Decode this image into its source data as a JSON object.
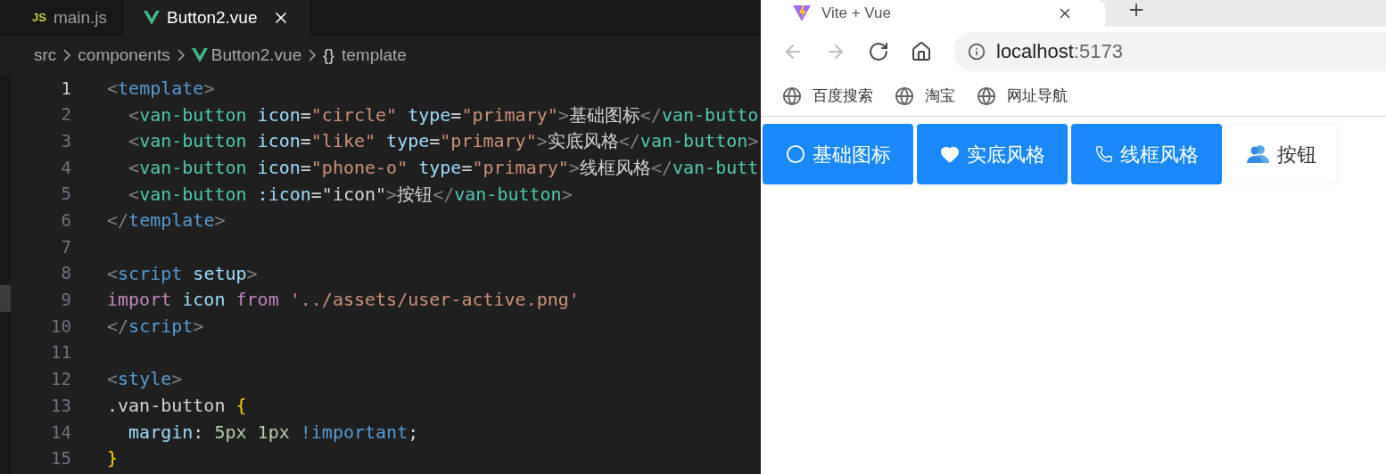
{
  "editor": {
    "tabs": [
      {
        "label": "main.js",
        "kind": "js",
        "badge": "JS",
        "selected": false
      },
      {
        "label": "Button2.vue",
        "kind": "vue",
        "selected": true
      }
    ],
    "breadcrumb": [
      {
        "label": "src",
        "kind": "folder"
      },
      {
        "label": "components",
        "kind": "folder"
      },
      {
        "label": "Button2.vue",
        "kind": "vue"
      },
      {
        "label": "template",
        "kind": "symbol",
        "glyph": "{}"
      }
    ],
    "lines": [
      {
        "number": "1",
        "active": true,
        "tokens": [
          {
            "kind": "punct",
            "text": "<"
          },
          {
            "kind": "tag",
            "text": "template"
          },
          {
            "kind": "punct",
            "text": ">"
          }
        ]
      },
      {
        "number": "2",
        "active": false,
        "tokens": [
          {
            "kind": "punct",
            "text": "  <"
          },
          {
            "kind": "component",
            "text": "van-button"
          },
          {
            "kind": "attr",
            "text": " icon"
          },
          {
            "kind": "plain",
            "text": "="
          },
          {
            "kind": "string",
            "text": "\"circle\""
          },
          {
            "kind": "attr",
            "text": " type"
          },
          {
            "kind": "plain",
            "text": "="
          },
          {
            "kind": "string",
            "text": "\"primary\""
          },
          {
            "kind": "punct",
            "text": ">"
          },
          {
            "kind": "plain",
            "text": "基础图标"
          },
          {
            "kind": "punct",
            "text": "</"
          },
          {
            "kind": "component",
            "text": "van-butto"
          }
        ]
      },
      {
        "number": "3",
        "active": false,
        "tokens": [
          {
            "kind": "punct",
            "text": "  <"
          },
          {
            "kind": "component",
            "text": "van-button"
          },
          {
            "kind": "attr",
            "text": " icon"
          },
          {
            "kind": "plain",
            "text": "="
          },
          {
            "kind": "string",
            "text": "\"like\""
          },
          {
            "kind": "attr",
            "text": " type"
          },
          {
            "kind": "plain",
            "text": "="
          },
          {
            "kind": "string",
            "text": "\"primary\""
          },
          {
            "kind": "punct",
            "text": ">"
          },
          {
            "kind": "plain",
            "text": "实底风格"
          },
          {
            "kind": "punct",
            "text": "</"
          },
          {
            "kind": "component",
            "text": "van-button"
          },
          {
            "kind": "punct",
            "text": ">"
          }
        ]
      },
      {
        "number": "4",
        "active": false,
        "tokens": [
          {
            "kind": "punct",
            "text": "  <"
          },
          {
            "kind": "component",
            "text": "van-button"
          },
          {
            "kind": "attr",
            "text": " icon"
          },
          {
            "kind": "plain",
            "text": "="
          },
          {
            "kind": "string",
            "text": "\"phone-o\""
          },
          {
            "kind": "attr",
            "text": " type"
          },
          {
            "kind": "plain",
            "text": "="
          },
          {
            "kind": "string",
            "text": "\"primary\""
          },
          {
            "kind": "punct",
            "text": ">"
          },
          {
            "kind": "plain",
            "text": "线框风格"
          },
          {
            "kind": "punct",
            "text": "</"
          },
          {
            "kind": "component",
            "text": "van-butt"
          }
        ]
      },
      {
        "number": "5",
        "active": false,
        "tokens": [
          {
            "kind": "punct",
            "text": "  <"
          },
          {
            "kind": "component",
            "text": "van-button"
          },
          {
            "kind": "attr",
            "text": " :icon"
          },
          {
            "kind": "plain",
            "text": "=\"icon\""
          },
          {
            "kind": "punct",
            "text": ">"
          },
          {
            "kind": "plain",
            "text": "按钮"
          },
          {
            "kind": "punct",
            "text": "</"
          },
          {
            "kind": "component",
            "text": "van-button"
          },
          {
            "kind": "punct",
            "text": ">"
          }
        ]
      },
      {
        "number": "6",
        "active": false,
        "tokens": [
          {
            "kind": "punct",
            "text": "</"
          },
          {
            "kind": "tag",
            "text": "template"
          },
          {
            "kind": "punct",
            "text": ">"
          }
        ]
      },
      {
        "number": "7",
        "active": false
      },
      {
        "number": "8",
        "active": false,
        "tokens": [
          {
            "kind": "punct",
            "text": "<"
          },
          {
            "kind": "tag",
            "text": "script"
          },
          {
            "kind": "attr",
            "text": " setup"
          },
          {
            "kind": "punct",
            "text": ">"
          }
        ]
      },
      {
        "number": "9",
        "active": false,
        "tokens": [
          {
            "kind": "keyword",
            "text": "import"
          },
          {
            "kind": "attr",
            "text": " icon"
          },
          {
            "kind": "keyword",
            "text": " from"
          },
          {
            "kind": "string",
            "text": " '../assets/user-active.png'"
          }
        ]
      },
      {
        "number": "10",
        "active": false,
        "tokens": [
          {
            "kind": "punct",
            "text": "</"
          },
          {
            "kind": "tag",
            "text": "script"
          },
          {
            "kind": "punct",
            "text": ">"
          }
        ]
      },
      {
        "number": "11",
        "active": false
      },
      {
        "number": "12",
        "active": false,
        "tokens": [
          {
            "kind": "punct",
            "text": "<"
          },
          {
            "kind": "tag",
            "text": "style"
          },
          {
            "kind": "punct",
            "text": ">"
          }
        ]
      },
      {
        "number": "13",
        "active": false,
        "tokens": [
          {
            "kind": "plain",
            "text": ".van-button "
          },
          {
            "kind": "brace",
            "text": "{"
          }
        ]
      },
      {
        "number": "14",
        "active": false,
        "tokens": [
          {
            "kind": "attr",
            "text": "  margin"
          },
          {
            "kind": "plain",
            "text": ": "
          },
          {
            "kind": "number",
            "text": "5px 1px"
          },
          {
            "kind": "tag",
            "text": " !important"
          },
          {
            "kind": "plain",
            "text": ";"
          }
        ]
      },
      {
        "number": "15",
        "active": false,
        "tokens": [
          {
            "kind": "brace",
            "text": "}"
          }
        ]
      }
    ]
  },
  "browser": {
    "tab": {
      "title": "Vite + Vue"
    },
    "address": {
      "host": "localhost",
      "port": ":5173"
    },
    "nav": [
      {
        "kind": "back",
        "disabled": true
      },
      {
        "kind": "forward",
        "disabled": true
      },
      {
        "kind": "reload",
        "disabled": false
      },
      {
        "kind": "home",
        "disabled": false
      }
    ],
    "bookmarks": [
      "百度搜索",
      "淘宝",
      "网址导航"
    ],
    "buttons": [
      {
        "label": "基础图标",
        "kind": "circle",
        "primary": true
      },
      {
        "label": "实底风格",
        "kind": "heart",
        "primary": true
      },
      {
        "label": "线框风格",
        "kind": "phone",
        "primary": true
      },
      {
        "label": "按钮",
        "kind": "user",
        "primary": false
      }
    ]
  }
}
